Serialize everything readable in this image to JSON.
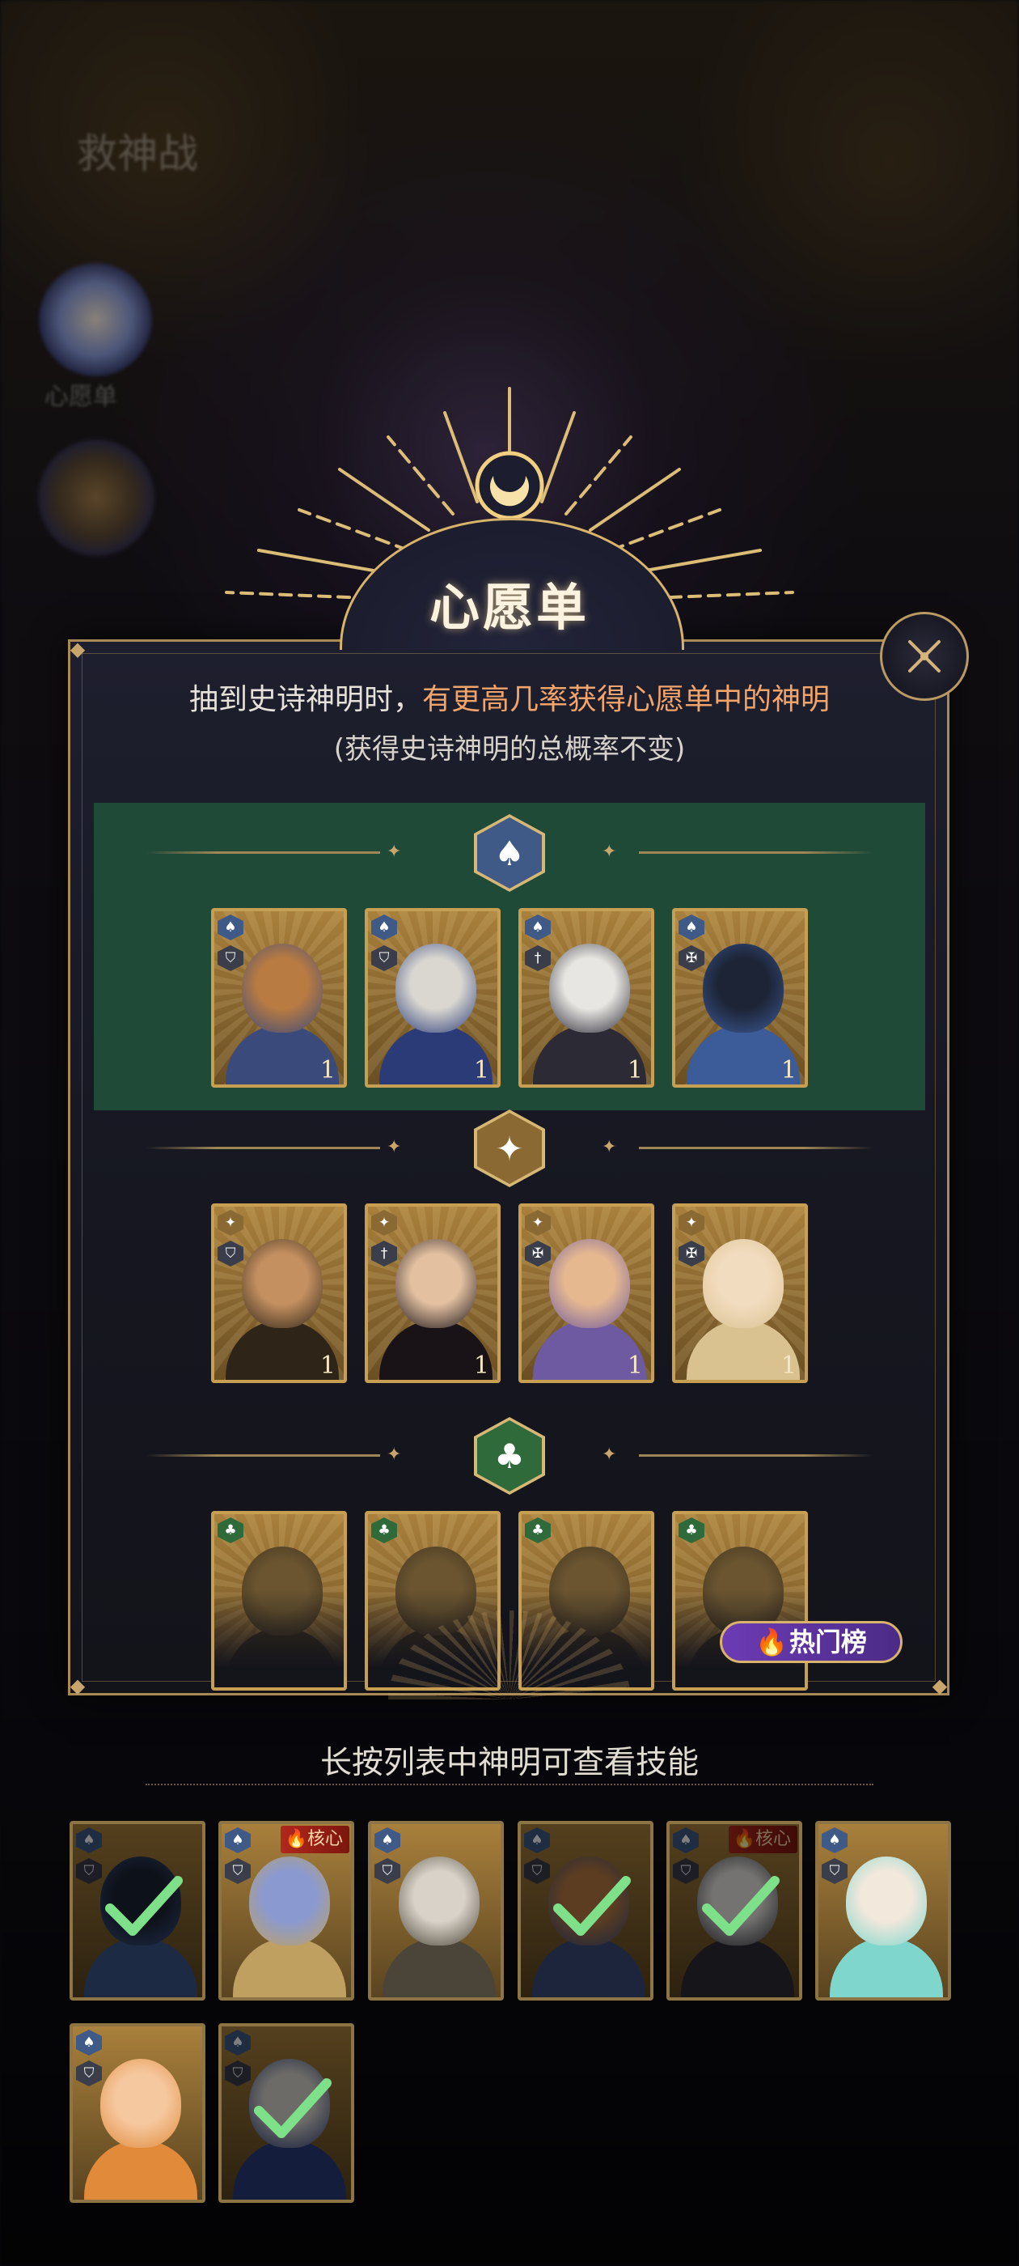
{
  "background": {
    "side_title": "救神战",
    "side_label": "心愿单"
  },
  "modal": {
    "title": "心愿单",
    "desc_prefix": "抽到史诗神明时，",
    "desc_highlight": "有更高几率获得心愿单中的神明",
    "desc_note": "(获得史诗神明的总概率不变)",
    "hot_button": "热门榜",
    "sections": [
      {
        "suit": "spade-icon",
        "suit_color": "#3f5a86",
        "highlight_color": "#1f4a38",
        "cards": [
          {
            "count": "1",
            "badge": "shield-icon",
            "palette": [
              "#b87b42",
              "#3a4a7a"
            ]
          },
          {
            "count": "1",
            "badge": "shield-icon",
            "palette": [
              "#d9d7d0",
              "#2a3b78"
            ]
          },
          {
            "count": "1",
            "badge": "sword-icon",
            "palette": [
              "#e8e6e2",
              "#2b2a35"
            ]
          },
          {
            "count": "1",
            "badge": "cross-icon",
            "palette": [
              "#1d2436",
              "#3c5b99"
            ]
          }
        ]
      },
      {
        "suit": "star-icon",
        "suit_color": "#8a6a32",
        "cards": [
          {
            "count": "1",
            "badge": "shield-icon",
            "palette": [
              "#c49060",
              "#2e2418"
            ]
          },
          {
            "count": "1",
            "badge": "sword-icon",
            "palette": [
              "#e2c0a0",
              "#191317"
            ]
          },
          {
            "count": "1",
            "badge": "cross-icon",
            "palette": [
              "#e5b890",
              "#6e5aa0"
            ]
          },
          {
            "count": "1",
            "badge": "cross-icon",
            "palette": [
              "#f2dcc0",
              "#d9c290"
            ]
          }
        ]
      },
      {
        "suit": "club-icon",
        "suit_color": "#2f6a3a",
        "cards": [
          {
            "count": "",
            "badge": "",
            "palette": [
              "#6a5530",
              "#3a2e1c"
            ]
          },
          {
            "count": "",
            "badge": "",
            "palette": [
              "#6a5530",
              "#3a2e1c"
            ]
          },
          {
            "count": "",
            "badge": "",
            "palette": [
              "#6a5530",
              "#3a2e1c"
            ]
          },
          {
            "count": "",
            "badge": "",
            "palette": [
              "#6a5530",
              "#3a2e1c"
            ]
          }
        ]
      }
    ]
  },
  "hint": "长按列表中神明可查看技能",
  "owned": [
    {
      "checked": true,
      "core": "",
      "palette": [
        "#1b2232",
        "#3b5488"
      ]
    },
    {
      "checked": false,
      "core": "核心",
      "palette": [
        "#8a9ad0",
        "#c0a060"
      ]
    },
    {
      "checked": false,
      "core": "",
      "palette": [
        "#d8d2c8",
        "#4a4538"
      ]
    },
    {
      "checked": true,
      "core": "",
      "palette": [
        "#b87b42",
        "#3a4a7a"
      ]
    },
    {
      "checked": true,
      "core": "核心",
      "palette": [
        "#e8e6e2",
        "#2b2a35"
      ]
    },
    {
      "checked": false,
      "core": "",
      "palette": [
        "#f2e8dc",
        "#7ed6cc"
      ]
    },
    {
      "checked": false,
      "core": "",
      "palette": [
        "#f6c8a0",
        "#e08a3a"
      ]
    },
    {
      "checked": true,
      "core": "",
      "palette": [
        "#d9d7d0",
        "#2a3b78"
      ]
    }
  ]
}
